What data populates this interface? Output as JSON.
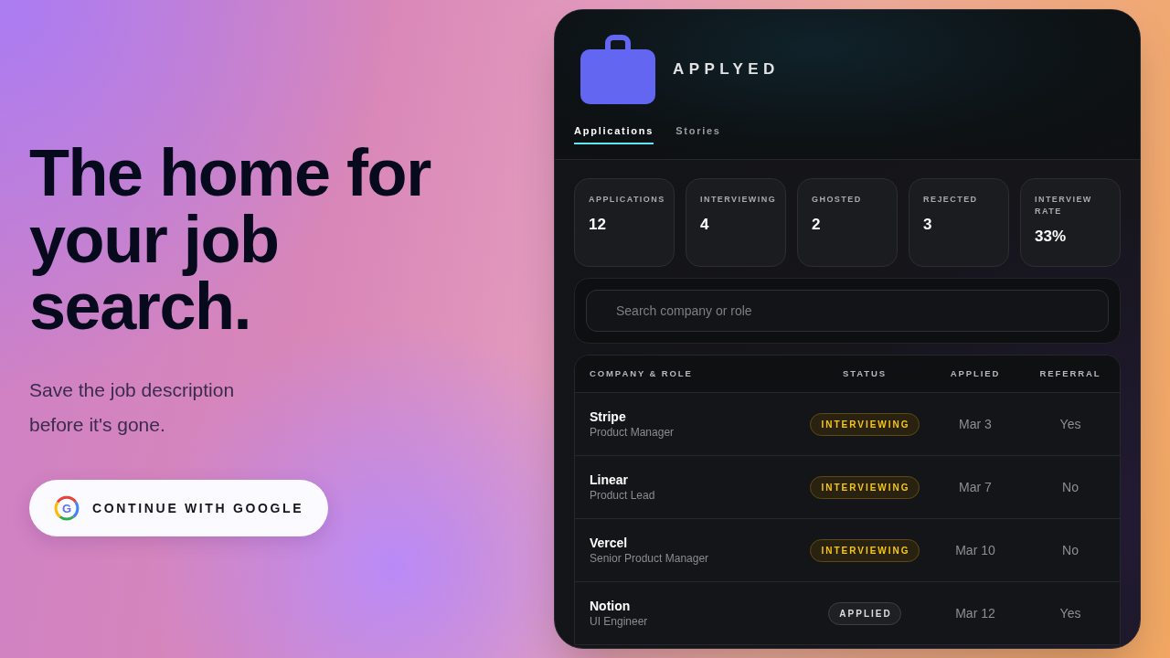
{
  "hero": {
    "headline": "The home for your job search.",
    "subtitle": "Save the job description before it's gone.",
    "auth_button": {
      "label": "CONTINUE WITH GOOGLE",
      "icon_letter": "G"
    }
  },
  "app": {
    "title": "APPLYED",
    "tabs": [
      {
        "label": "Applications",
        "selected": true
      },
      {
        "label": "Stories",
        "selected": false
      }
    ],
    "stats": [
      {
        "label": "APPLICATIONS",
        "value": "12"
      },
      {
        "label": "INTERVIEWING",
        "value": "4"
      },
      {
        "label": "GHOSTED",
        "value": "2"
      },
      {
        "label": "REJECTED",
        "value": "3"
      },
      {
        "label": "INTERVIEW RATE",
        "value": "33%"
      }
    ],
    "search": {
      "placeholder": "Search company or role"
    },
    "table": {
      "columns": [
        "COMPANY & ROLE",
        "STATUS",
        "APPLIED",
        "REFERRAL"
      ],
      "rows": [
        {
          "company": "Stripe",
          "role": "Product Manager",
          "status": {
            "label": "INTERVIEWING",
            "kind": "interviewing"
          },
          "applied": "Mar 3",
          "referral": "Yes"
        },
        {
          "company": "Linear",
          "role": "Product Lead",
          "status": {
            "label": "INTERVIEWING",
            "kind": "interviewing"
          },
          "applied": "Mar 7",
          "referral": "No"
        },
        {
          "company": "Vercel",
          "role": "Senior Product Manager",
          "status": {
            "label": "INTERVIEWING",
            "kind": "interviewing"
          },
          "applied": "Mar 10",
          "referral": "No"
        },
        {
          "company": "Notion",
          "role": "UI Engineer",
          "status": {
            "label": "APPLIED",
            "kind": "applied"
          },
          "applied": "Mar 12",
          "referral": "Yes"
        }
      ]
    }
  }
}
